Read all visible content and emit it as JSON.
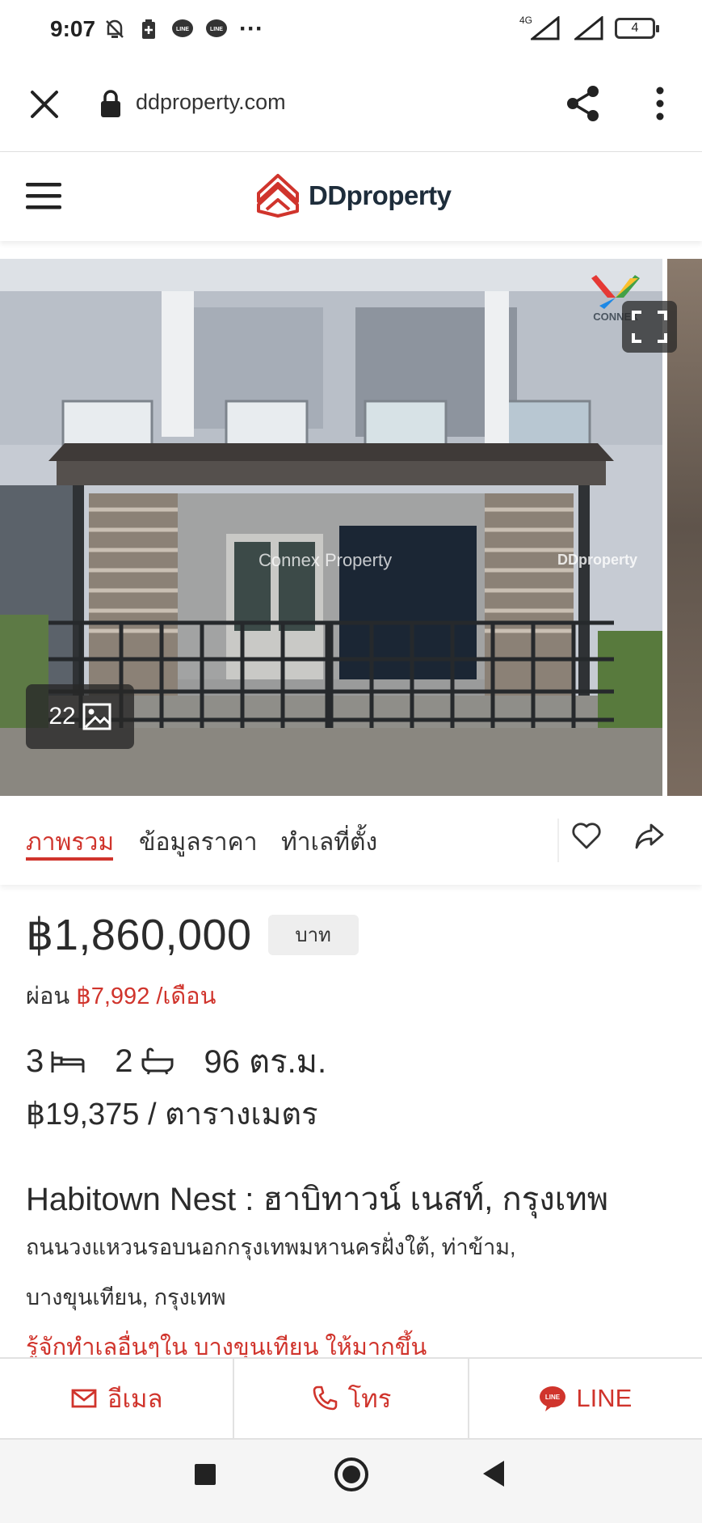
{
  "status_bar": {
    "time": "9:07",
    "network": "4G",
    "battery": "4",
    "more": "···",
    "icons": [
      "mute-icon",
      "battery-saver-icon",
      "line-chat-icon",
      "line-icon",
      "more-dots-icon",
      "signal-icon",
      "signal-icon",
      "battery-icon"
    ]
  },
  "browser": {
    "url": "ddproperty.com",
    "icons": [
      "close-icon",
      "lock-icon",
      "share-icon",
      "more-vertical-icon"
    ]
  },
  "header": {
    "logo_text": "DDproperty",
    "icons": [
      "hamburger-menu-icon",
      "ddproperty-logo-icon"
    ]
  },
  "gallery": {
    "photo_count": "22",
    "watermark_agent": "Connex Property",
    "watermark_site": "DDproperty",
    "agent_logo_text": "CONNEX",
    "icons": [
      "expand-icon",
      "image-icon"
    ]
  },
  "tabs": {
    "items": [
      {
        "label": "ภาพรวม",
        "active": true
      },
      {
        "label": "ข้อมูลราคา",
        "active": false
      },
      {
        "label": "ทำเลที่ตั้ง",
        "active": false
      }
    ],
    "icons": [
      "heart-icon",
      "share-arrow-icon"
    ]
  },
  "listing": {
    "price": "฿1,860,000",
    "price_unit": "บาท",
    "mortgage_label": "ผ่อน",
    "mortgage_value": "฿7,992 /เดือน",
    "bedrooms": "3",
    "bathrooms": "2",
    "area": "96 ตร.ม.",
    "price_per_sqm": "฿19,375 / ตารางเมตร",
    "title": "Habitown Nest : ฮาบิทาวน์ เนสท์, กรุงเทพ",
    "address_line1": "ถนนวงแหวนรอบนอกกรุงเทพมหานครฝั่งใต้, ท่าข้าม,",
    "address_line2": "บางขุนเทียน, กรุงเทพ",
    "explore_link": "รู้จักทำเลอื่นๆใน บางขุนเทียน ให้มากขึ้น",
    "icons": [
      "bed-icon",
      "bathtub-icon"
    ]
  },
  "contact": {
    "email_label": "อีเมล",
    "call_label": "โทร",
    "line_label": "LINE",
    "icons": [
      "mail-icon",
      "phone-icon",
      "line-icon"
    ]
  },
  "nav": {
    "icons": [
      "recents-square-icon",
      "home-circle-icon",
      "back-triangle-icon"
    ]
  },
  "colors": {
    "accent": "#d0342c",
    "text": "#2b2b2b",
    "logo_dark": "#1e2d3b"
  }
}
